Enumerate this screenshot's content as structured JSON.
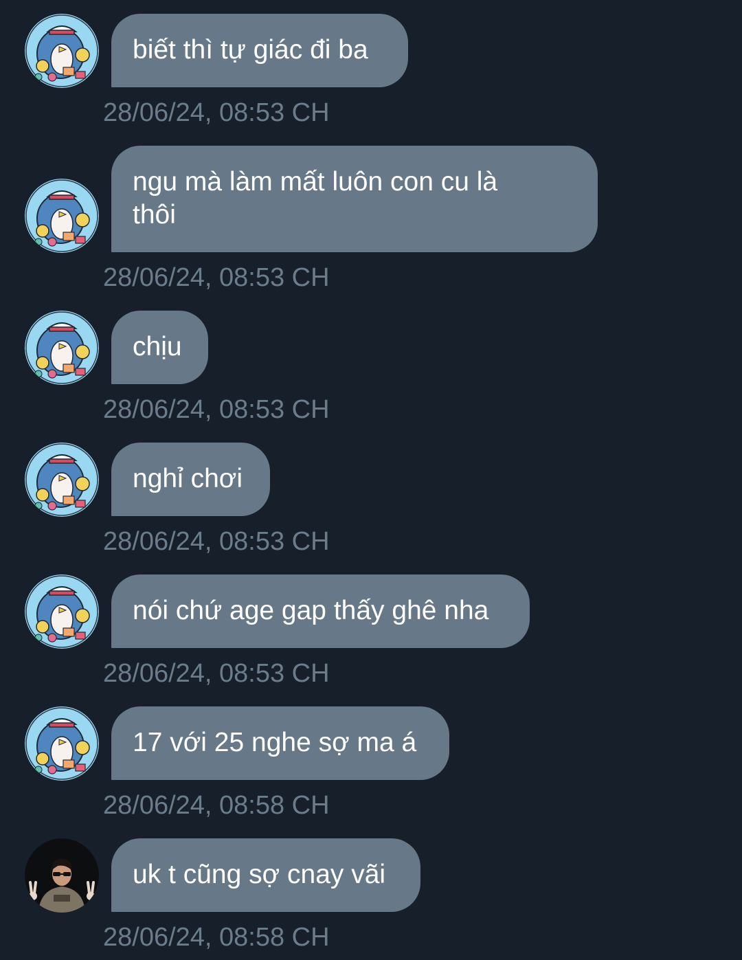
{
  "messages": [
    {
      "text": "biết thì tự giác đi ba",
      "time": "28/06/24, 08:53 CH",
      "avatar": "penguin-icon"
    },
    {
      "text": "ngu mà làm mất luôn con cu là\nthôi",
      "time": "28/06/24, 08:53 CH",
      "avatar": "penguin-icon"
    },
    {
      "text": "chịu",
      "time": "28/06/24, 08:53 CH",
      "avatar": "penguin-icon"
    },
    {
      "text": "nghỉ chơi",
      "time": "28/06/24, 08:53 CH",
      "avatar": "penguin-icon"
    },
    {
      "text": "nói chứ age gap thấy ghê nha",
      "time": "28/06/24, 08:53 CH",
      "avatar": "penguin-icon"
    },
    {
      "text": "17 với 25 nghe sợ ma á",
      "time": "28/06/24, 08:58 CH",
      "avatar": "penguin-icon"
    },
    {
      "text": "uk t cũng sợ cnay vãi",
      "time": "28/06/24, 08:58 CH",
      "avatar": "person-photo-icon"
    }
  ],
  "colors": {
    "background": "#17202a",
    "bubble": "#677888",
    "timestamp": "#6b7d8c",
    "avatar_bg": "#8fd4f0"
  }
}
